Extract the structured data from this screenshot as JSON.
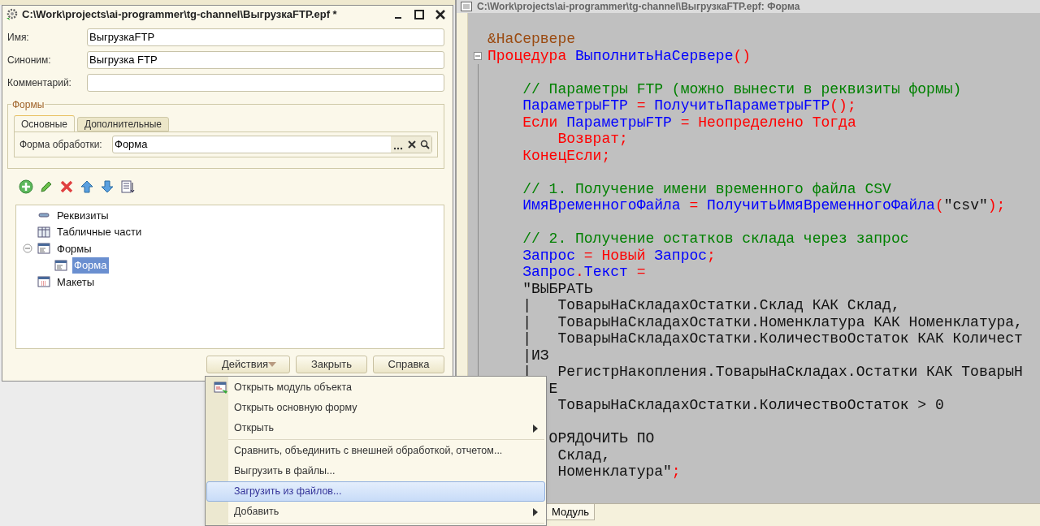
{
  "object_window": {
    "title": "C:\\Work\\projects\\ai-programmer\\tg-channel\\ВыгрузкаFTP.epf *",
    "fields": [
      {
        "label": "Имя:",
        "value": "ВыгрузкаFTP"
      },
      {
        "label": "Синоним:",
        "value": "Выгрузка FTP"
      },
      {
        "label": "Комментарий:"
      }
    ],
    "forms_group": {
      "title": "Формы",
      "tabs": [
        {
          "label": "Основные",
          "selected": true
        },
        {
          "label": "Дополнительные",
          "selected": false
        }
      ],
      "field": {
        "label": "Форма обработки:",
        "value": "Форма"
      }
    },
    "tree": [
      {
        "label": "Реквизиты",
        "kind": "attributes",
        "selected": false
      },
      {
        "label": "Табличные части",
        "kind": "tables",
        "selected": false
      },
      {
        "label": "Формы",
        "kind": "forms",
        "selected": false,
        "expanded": true,
        "children": [
          {
            "label": "Форма",
            "kind": "form",
            "selected": true
          }
        ]
      },
      {
        "label": "Макеты",
        "kind": "layouts",
        "selected": false
      }
    ],
    "buttons": [
      {
        "label": "Действия",
        "kind": "dropdown"
      },
      {
        "label": "Закрыть",
        "kind": "plain"
      },
      {
        "label": "Справка",
        "kind": "plain"
      }
    ]
  },
  "context_menu": {
    "items": [
      {
        "kind": "icon_item",
        "label": "Открыть модуль объекта",
        "submenu": false,
        "selected": false
      },
      {
        "kind": "item",
        "label": "Открыть основную форму",
        "submenu": false,
        "selected": false
      },
      {
        "kind": "item",
        "label": "Открыть",
        "submenu": true,
        "selected": false
      },
      {
        "kind": "separator"
      },
      {
        "kind": "item",
        "label": "Сравнить, объединить с внешней обработкой, отчетом...",
        "submenu": false,
        "selected": false
      },
      {
        "kind": "item",
        "label": "Выгрузить в файлы...",
        "submenu": false,
        "selected": false
      },
      {
        "kind": "item",
        "label": "Загрузить из файлов...",
        "submenu": false,
        "selected": true
      },
      {
        "kind": "item",
        "label": "Добавить",
        "submenu": true,
        "selected": false
      },
      {
        "kind": "separator"
      }
    ]
  },
  "editor_window": {
    "title": "C:\\Work\\projects\\ai-programmer\\tg-channel\\ВыгрузкаFTP.epf: Форма",
    "lines": [
      {
        "kind": "code",
        "tokens": [
          {
            "text": "&НаСервере",
            "kind": "directive"
          }
        ]
      },
      {
        "kind": "code",
        "fold": true,
        "tokens": [
          {
            "text": "Процедура ",
            "kind": "keyword"
          },
          {
            "text": "ВыполнитьНаСервере",
            "kind": "ident"
          },
          {
            "text": "()",
            "kind": "op"
          }
        ]
      },
      {
        "kind": "blank"
      },
      {
        "kind": "code",
        "tokens": [
          {
            "text": "    // Параметры FTP (можно вынести в реквизиты формы)",
            "kind": "comment"
          }
        ]
      },
      {
        "kind": "code",
        "tokens": [
          {
            "text": "    ПараметрыFTP ",
            "kind": "ident"
          },
          {
            "text": "= ",
            "kind": "op"
          },
          {
            "text": "ПолучитьПараметрыFTP",
            "kind": "ident"
          },
          {
            "text": "();",
            "kind": "op"
          }
        ]
      },
      {
        "kind": "code",
        "tokens": [
          {
            "text": "    Если ",
            "kind": "keyword"
          },
          {
            "text": "ПараметрыFTP ",
            "kind": "ident"
          },
          {
            "text": "= Неопределено Тогда",
            "kind": "keyword"
          }
        ]
      },
      {
        "kind": "code",
        "tokens": [
          {
            "text": "        Возврат;",
            "kind": "keyword"
          }
        ]
      },
      {
        "kind": "code",
        "tokens": [
          {
            "text": "    КонецЕсли;",
            "kind": "keyword"
          }
        ]
      },
      {
        "kind": "blank"
      },
      {
        "kind": "code",
        "tokens": [
          {
            "text": "    // 1. Получение имени временного файла CSV",
            "kind": "comment"
          }
        ]
      },
      {
        "kind": "code",
        "tokens": [
          {
            "text": "    ИмяВременногоФайла ",
            "kind": "ident"
          },
          {
            "text": "= ",
            "kind": "op"
          },
          {
            "text": "ПолучитьИмяВременногоФайла",
            "kind": "ident"
          },
          {
            "text": "(",
            "kind": "op"
          },
          {
            "text": "\"csv\"",
            "kind": "string"
          },
          {
            "text": ");",
            "kind": "op"
          }
        ]
      },
      {
        "kind": "blank"
      },
      {
        "kind": "code",
        "tokens": [
          {
            "text": "    // 2. Получение остатков склада через запрос",
            "kind": "comment"
          }
        ]
      },
      {
        "kind": "code",
        "tokens": [
          {
            "text": "    Запрос ",
            "kind": "ident"
          },
          {
            "text": "= Новый ",
            "kind": "keyword"
          },
          {
            "text": "Запрос",
            "kind": "ident"
          },
          {
            "text": ";",
            "kind": "op"
          }
        ]
      },
      {
        "kind": "code",
        "tokens": [
          {
            "text": "    Запрос",
            "kind": "ident"
          },
          {
            "text": ".",
            "kind": "op"
          },
          {
            "text": "Текст ",
            "kind": "ident"
          },
          {
            "text": "=",
            "kind": "op"
          }
        ]
      },
      {
        "kind": "code",
        "tokens": [
          {
            "text": "    \"ВЫБРАТЬ",
            "kind": "string"
          }
        ]
      },
      {
        "kind": "code",
        "tokens": [
          {
            "text": "    |   ТоварыНаСкладахОстатки.Склад КАК Склад,",
            "kind": "string"
          }
        ]
      },
      {
        "kind": "code",
        "tokens": [
          {
            "text": "    |   ТоварыНаСкладахОстатки.Номенклатура КАК Номенклатура,",
            "kind": "string"
          }
        ]
      },
      {
        "kind": "code",
        "tokens": [
          {
            "text": "    |   ТоварыНаСкладахОстатки.КоличествоОстаток КАК Количест",
            "kind": "string"
          }
        ]
      },
      {
        "kind": "code",
        "tokens": [
          {
            "text": "    |ИЗ",
            "kind": "string"
          }
        ]
      },
      {
        "kind": "code",
        "tokens": [
          {
            "text": "    |   РегистрНакопления.ТоварыНаСкладах.Остатки КАК ТоварыН",
            "kind": "string"
          }
        ]
      },
      {
        "kind": "code",
        "tokens": [
          {
            "text": "       Е",
            "kind": "string"
          }
        ]
      },
      {
        "kind": "code",
        "tokens": [
          {
            "text": "        ТоварыНаСкладахОстатки.КоличествоОстаток > 0",
            "kind": "string"
          }
        ]
      },
      {
        "kind": "blank"
      },
      {
        "kind": "code",
        "tokens": [
          {
            "text": "       ОРЯДОЧИТЬ ПО",
            "kind": "string"
          }
        ]
      },
      {
        "kind": "code",
        "tokens": [
          {
            "text": "        Склад,",
            "kind": "string"
          }
        ]
      },
      {
        "kind": "code",
        "tokens": [
          {
            "text": "        Номенклатура\"",
            "kind": "string"
          },
          {
            "text": ";",
            "kind": "op"
          }
        ]
      }
    ],
    "tabs": [
      {
        "label": "Модуль",
        "selected": true
      }
    ]
  }
}
